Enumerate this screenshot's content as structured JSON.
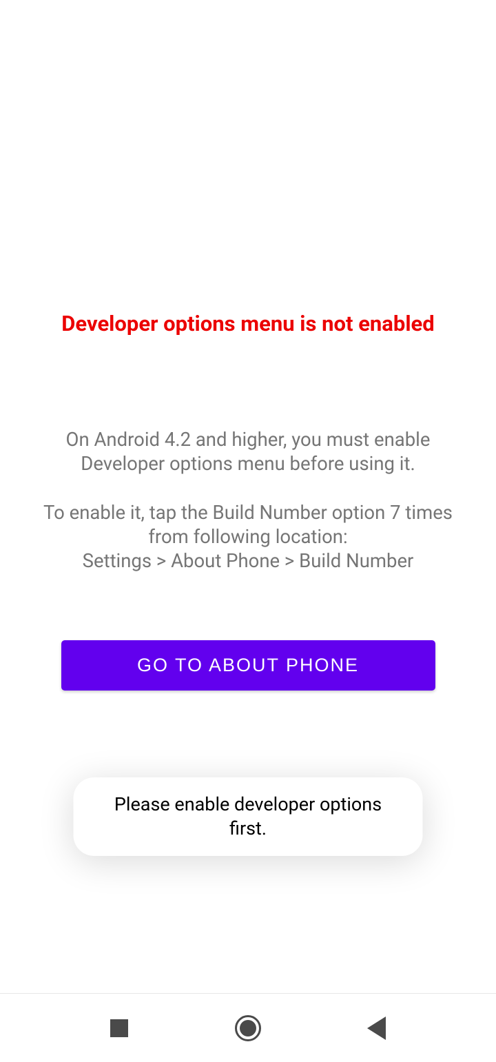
{
  "title": "Developer options menu is not enabled",
  "description": "On Android 4.2 and higher, you must enable Developer options menu before using it.\n\nTo enable it, tap the Build Number option 7 times from following location:\nSettings > About Phone > Build Number",
  "button": {
    "label": "GO TO ABOUT PHONE"
  },
  "toast": {
    "message": "Please enable developer options first."
  },
  "colors": {
    "error": "#eb0000",
    "accent": "#6200EE",
    "text_secondary": "#757575"
  }
}
